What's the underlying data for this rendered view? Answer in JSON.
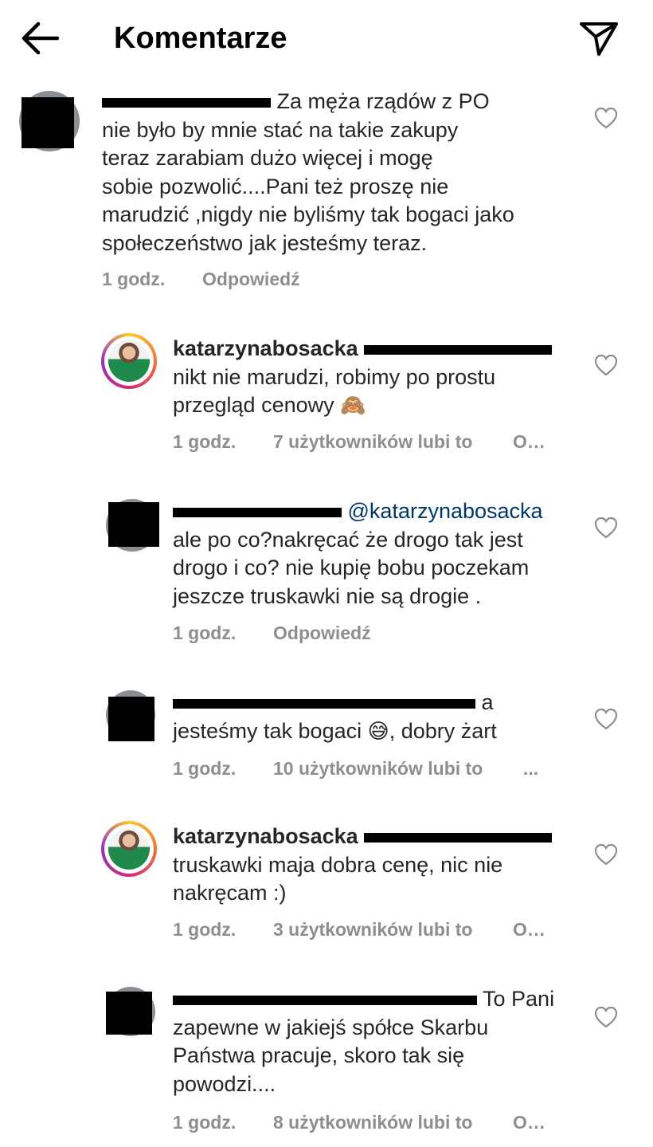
{
  "header": {
    "title": "Komentarze",
    "back_icon": "arrow-left-icon",
    "send_icon": "paper-plane-icon"
  },
  "comments": [
    {
      "username_visible": "",
      "text": "Za  męża rządów z PO",
      "lines": [
        "nie było by mnie stać na takie zakupy",
        "teraz zarabiam dużo więcej i mogę",
        "sobie pozwolić....Pani też proszę nie",
        "marudzić ,nigdy nie byliśmy tak bogaci jako",
        "społeczeństwo jak jesteśmy teraz."
      ],
      "time": "1 godz.",
      "action": "Odpowiedź"
    },
    {
      "username": "katarzynabosacka",
      "lines": [
        "nikt nie marudzi, robimy po prostu",
        "przegląd cenowy"
      ],
      "emoji": "🙈",
      "time": "1 godz.",
      "likes": "7 użytkowników lubi to",
      "action": "O…"
    },
    {
      "mention": "@katarzynabosacka",
      "lines": [
        "ale po co?nakręcać że drogo tak jest",
        "drogo i co? nie kupię bobu poczekam",
        "jeszcze truskawki nie są  drogie ."
      ],
      "time": "1 godz.",
      "action": "Odpowiedź"
    },
    {
      "tail": "a",
      "line2": "jesteśmy tak bogaci",
      "emoji": "😅",
      "line2_end": ", dobry żart",
      "time": "1 godz.",
      "likes": "10 użytkowników lubi to",
      "action": "..."
    },
    {
      "username": "katarzynabosacka",
      "lines": [
        "truskawki maja dobra cenę, nic nie",
        "nakręcam :)"
      ],
      "time": "1 godz.",
      "likes": "3 użytkowników lubi to",
      "action": "O…"
    },
    {
      "tail": "To Pani",
      "lines": [
        "zapewne w jakiejś spółce Skarbu",
        "Państwa pracuje, skoro tak się",
        "powodzi...."
      ],
      "time": "1 godz.",
      "likes": "8 użytkowników lubi to",
      "action": "O…"
    }
  ],
  "icons": {
    "like": "heart-outline-icon"
  }
}
